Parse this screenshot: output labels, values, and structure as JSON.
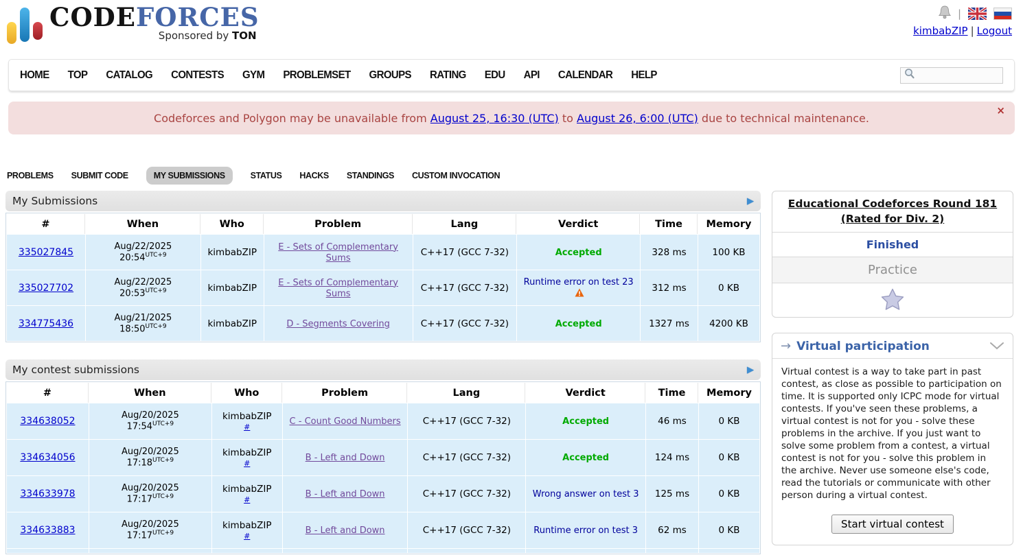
{
  "header": {
    "logo": {
      "code": "CODE",
      "forces": "FORCES",
      "tagline_prefix": "Sponsored by ",
      "tagline_brand": "TON"
    },
    "user": {
      "username": "kimbabZIP",
      "logout": "Logout",
      "separator": "|"
    }
  },
  "nav": {
    "items": [
      "HOME",
      "TOP",
      "CATALOG",
      "CONTESTS",
      "GYM",
      "PROBLEMSET",
      "GROUPS",
      "RATING",
      "EDU",
      "API",
      "CALENDAR",
      "HELP"
    ]
  },
  "search": {
    "placeholder": ""
  },
  "banner": {
    "text_before": "Codeforces and Polygon may be unavailable from ",
    "link1": "August 25, 16:30 (UTC)",
    "text_mid": " to ",
    "link2": "August 26, 6:00 (UTC)",
    "text_after": " due to technical maintenance.",
    "close": "×"
  },
  "tabs": {
    "items": [
      "PROBLEMS",
      "SUBMIT CODE",
      "MY SUBMISSIONS",
      "STATUS",
      "HACKS",
      "STANDINGS",
      "CUSTOM INVOCATION"
    ],
    "active": "MY SUBMISSIONS"
  },
  "submissions_table": {
    "title": "My Submissions",
    "columns": [
      "#",
      "When",
      "Who",
      "Problem",
      "Lang",
      "Verdict",
      "Time",
      "Memory"
    ],
    "rows": [
      {
        "id": "335027845",
        "date": "Aug/22/2025",
        "time": "20:54",
        "tz": "UTC+9",
        "who": "kimbabZIP",
        "problem": "E - Sets of Complementary Sums",
        "lang": "C++17 (GCC 7-32)",
        "verdict": "Accepted",
        "verdict_type": "ok",
        "time_ms": "328 ms",
        "memory": "100 KB"
      },
      {
        "id": "335027702",
        "date": "Aug/22/2025",
        "time": "20:53",
        "tz": "UTC+9",
        "who": "kimbabZIP",
        "problem": "E - Sets of Complementary Sums",
        "lang": "C++17 (GCC 7-32)",
        "verdict": "Runtime error on test 23",
        "verdict_type": "fail",
        "has_warning_icon": true,
        "time_ms": "312 ms",
        "memory": "0 KB"
      },
      {
        "id": "334775436",
        "date": "Aug/21/2025",
        "time": "18:50",
        "tz": "UTC+9",
        "who": "kimbabZIP",
        "problem": "D - Segments Covering",
        "lang": "C++17 (GCC 7-32)",
        "verdict": "Accepted",
        "verdict_type": "ok",
        "time_ms": "1327 ms",
        "memory": "4200 KB"
      }
    ]
  },
  "contest_table": {
    "title": "My contest submissions",
    "columns": [
      "#",
      "When",
      "Who",
      "Problem",
      "Lang",
      "Verdict",
      "Time",
      "Memory"
    ],
    "rows": [
      {
        "id": "334638052",
        "date": "Aug/20/2025",
        "time": "17:54",
        "tz": "UTC+9",
        "who": "kimbabZIP",
        "who_link": "#",
        "problem": "C - Count Good Numbers",
        "lang": "C++17 (GCC 7-32)",
        "verdict": "Accepted",
        "verdict_type": "ok",
        "time_ms": "46 ms",
        "memory": "0 KB"
      },
      {
        "id": "334634056",
        "date": "Aug/20/2025",
        "time": "17:18",
        "tz": "UTC+9",
        "who": "kimbabZIP",
        "who_link": "#",
        "problem": "B - Left and Down",
        "lang": "C++17 (GCC 7-32)",
        "verdict": "Accepted",
        "verdict_type": "ok",
        "time_ms": "124 ms",
        "memory": "0 KB"
      },
      {
        "id": "334633978",
        "date": "Aug/20/2025",
        "time": "17:17",
        "tz": "UTC+9",
        "who": "kimbabZIP",
        "who_link": "#",
        "problem": "B - Left and Down",
        "lang": "C++17 (GCC 7-32)",
        "verdict": "Wrong answer on test 3",
        "verdict_type": "fail",
        "time_ms": "125 ms",
        "memory": "0 KB"
      },
      {
        "id": "334633883",
        "date": "Aug/20/2025",
        "time": "17:17",
        "tz": "UTC+9",
        "who": "kimbabZIP",
        "who_link": "#",
        "problem": "B - Left and Down",
        "lang": "C++17 (GCC 7-32)",
        "verdict": "Runtime error on test 3",
        "verdict_type": "fail",
        "time_ms": "62 ms",
        "memory": "0 KB"
      }
    ]
  },
  "sidebar": {
    "contest_box": {
      "title": "Educational Codeforces Round 181 (Rated for Div. 2)",
      "status": "Finished",
      "mode": "Practice"
    },
    "virtual_box": {
      "arrow": "→",
      "title": "Virtual participation",
      "body": "Virtual contest is a way to take part in past contest, as close as possible to participation on time. It is supported only ICPC mode for virtual contests. If you've seen these problems, a virtual contest is not for you - solve these problems in the archive. If you just want to solve some problem from a contest, a virtual contest is not for you - solve this problem in the archive. Never use someone else's code, read the tutorials or communicate with other person during a virtual contest.",
      "button": "Start virtual contest"
    }
  },
  "colors": {
    "link_blue": "#0000cc",
    "visited_purple": "#71499b",
    "accepted_green": "#00aa00",
    "verdict_fail_blue": "#00009b",
    "row_highlight": "#dbeefa",
    "banner_bg": "#f3dede",
    "banner_text": "#a94442",
    "sidebar_title_blue": "#3b63a8",
    "logo_forces_blue": "#4666a7",
    "warning_orange": "#e8650e"
  },
  "icons": {
    "bell": "notifications-bell-icon",
    "flag_en": "english-flag-icon",
    "flag_ru": "russian-flag-icon",
    "search": "search-icon",
    "caption_arrow": "▶",
    "chevron": "chevron-down-icon",
    "star": "favorite-star-icon",
    "warning": "warning-icon"
  }
}
